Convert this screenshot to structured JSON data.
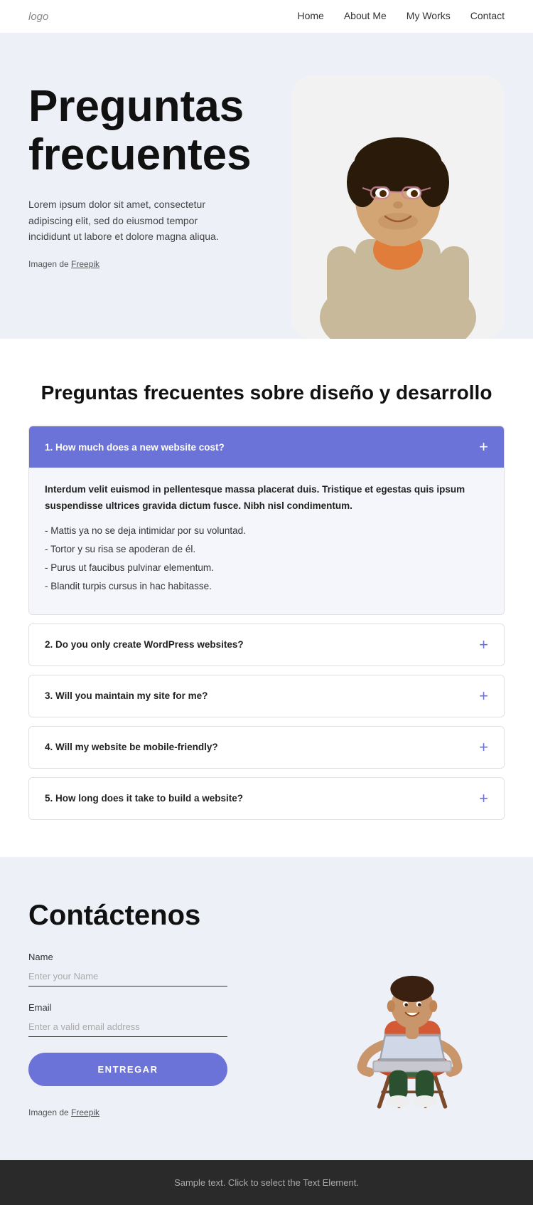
{
  "navbar": {
    "logo": "logo",
    "links": [
      {
        "label": "Home",
        "href": "#"
      },
      {
        "label": "About Me",
        "href": "#"
      },
      {
        "label": "My Works",
        "href": "#"
      },
      {
        "label": "Contact",
        "href": "#"
      }
    ]
  },
  "hero": {
    "title": "Preguntas frecuentes",
    "description": "Lorem ipsum dolor sit amet, consectetur adipiscing elit, sed do eiusmod tempor incididunt ut labore et dolore magna aliqua.",
    "image_credit_prefix": "Imagen de ",
    "image_credit_link": "Freepik"
  },
  "faq": {
    "section_title": "Preguntas frecuentes sobre diseño y desarrollo",
    "items": [
      {
        "question": "1. How much does a new website cost?",
        "active": true,
        "answer_bold": "Interdum velit euismod in pellentesque massa placerat duis. Tristique et egestas quis ipsum suspendisse ultrices gravida dictum fusce. Nibh nisl condimentum.",
        "answer_list": [
          "Mattis ya no se deja intimidar por su voluntad.",
          "Tortor y su risa se apoderan de él.",
          "Purus ut faucibus pulvinar elementum.",
          "Blandit turpis cursus in hac habitasse."
        ]
      },
      {
        "question": "2. Do you only create WordPress websites?",
        "active": false,
        "answer_bold": "",
        "answer_list": []
      },
      {
        "question": "3. Will you maintain my site for me?",
        "active": false,
        "answer_bold": "",
        "answer_list": []
      },
      {
        "question": "4. Will my website be mobile-friendly?",
        "active": false,
        "answer_bold": "",
        "answer_list": []
      },
      {
        "question": "5. How long does it take to build a website?",
        "active": false,
        "answer_bold": "",
        "answer_list": []
      }
    ]
  },
  "contact": {
    "title": "Contáctenos",
    "name_label": "Name",
    "name_placeholder": "Enter your Name",
    "email_label": "Email",
    "email_placeholder": "Enter a valid email address",
    "submit_label": "ENTREGAR",
    "image_credit_prefix": "Imagen de ",
    "image_credit_link": "Freepik"
  },
  "footer": {
    "text": "Sample text. Click to select the Text Element."
  }
}
